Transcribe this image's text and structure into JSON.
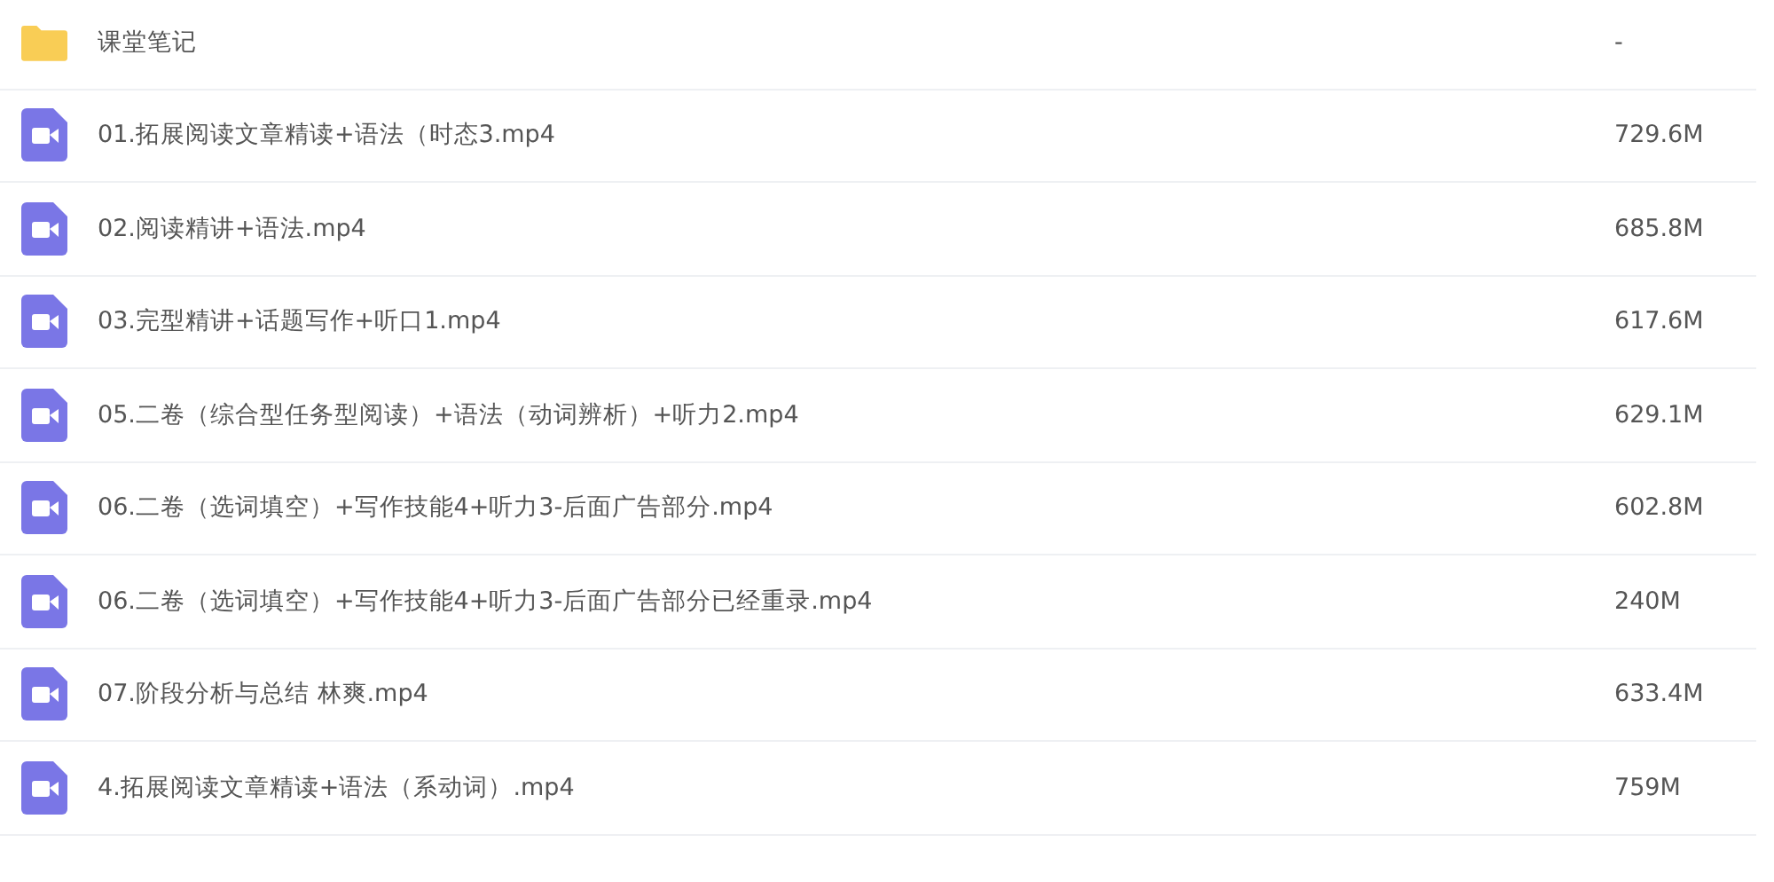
{
  "files": [
    {
      "kind": "folder",
      "name": "课堂笔记",
      "size": "-"
    },
    {
      "kind": "video",
      "name": "01.拓展阅读文章精读+语法（时态3.mp4",
      "size": "729.6M"
    },
    {
      "kind": "video",
      "name": "02.阅读精讲+语法.mp4",
      "size": "685.8M"
    },
    {
      "kind": "video",
      "name": "03.完型精讲+话题写作+听口1.mp4",
      "size": "617.6M"
    },
    {
      "kind": "video",
      "name": "05.二卷（综合型任务型阅读）+语法（动词辨析）+听力2.mp4",
      "size": "629.1M"
    },
    {
      "kind": "video",
      "name": "06.二卷（选词填空）+写作技能4+听力3-后面广告部分.mp4",
      "size": "602.8M"
    },
    {
      "kind": "video",
      "name": "06.二卷（选词填空）+写作技能4+听力3-后面广告部分已经重录.mp4",
      "size": "240M"
    },
    {
      "kind": "video",
      "name": "07.阶段分析与总结 林爽.mp4",
      "size": "633.4M"
    },
    {
      "kind": "video",
      "name": "4.拓展阅读文章精读+语法（系动词）.mp4",
      "size": "759M"
    }
  ]
}
